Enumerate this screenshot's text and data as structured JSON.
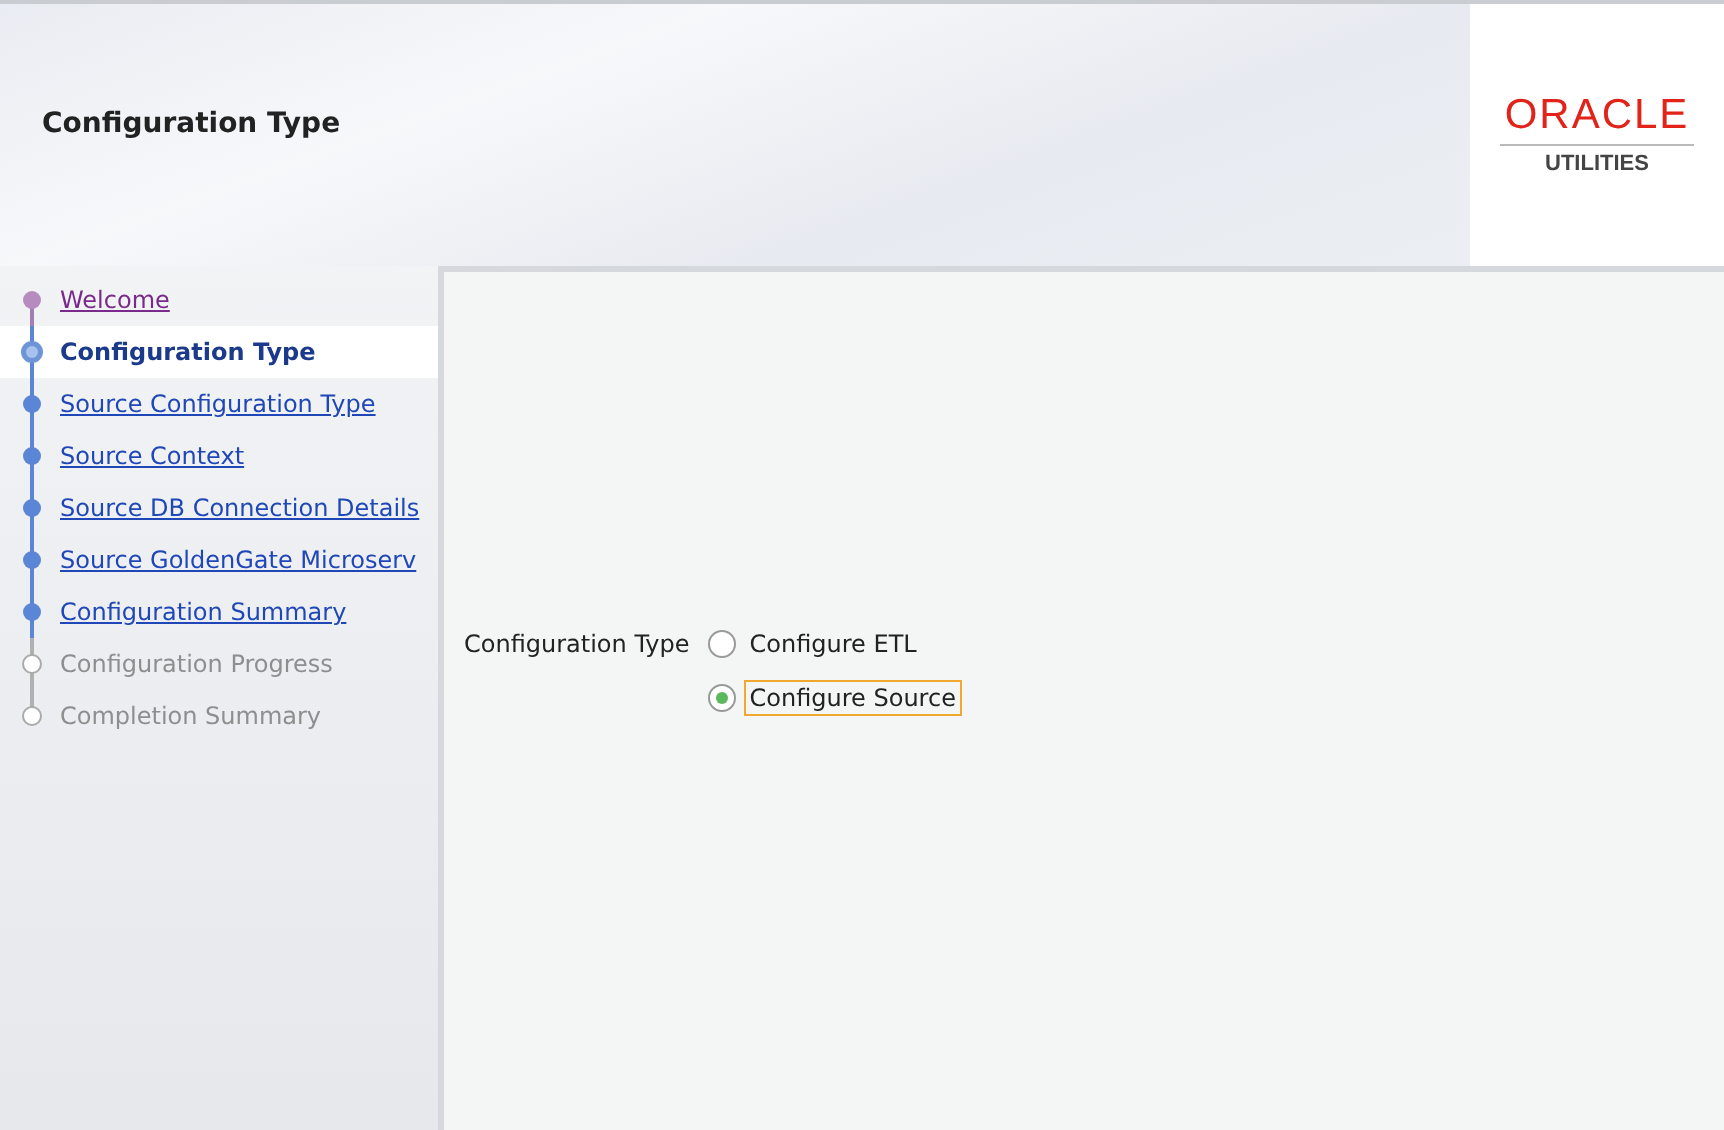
{
  "header": {
    "title": "Configuration Type",
    "logo": {
      "brand": "ORACLE",
      "product": "UTILITIES"
    }
  },
  "steps": [
    {
      "label": "Welcome",
      "kind": "visited"
    },
    {
      "label": "Configuration Type",
      "kind": "current"
    },
    {
      "label": "Source Configuration Type",
      "kind": "link"
    },
    {
      "label": "Source Context",
      "kind": "link"
    },
    {
      "label": "Source DB Connection Details",
      "kind": "link"
    },
    {
      "label": "Source GoldenGate Microserv",
      "kind": "link"
    },
    {
      "label": "Configuration Summary",
      "kind": "link"
    },
    {
      "label": "Configuration Progress",
      "kind": "disabled"
    },
    {
      "label": "Completion Summary",
      "kind": "disabled"
    }
  ],
  "form": {
    "label": "Configuration Type",
    "options": [
      {
        "label": "Configure ETL",
        "selected": false
      },
      {
        "label": "Configure Source",
        "selected": true
      }
    ]
  }
}
